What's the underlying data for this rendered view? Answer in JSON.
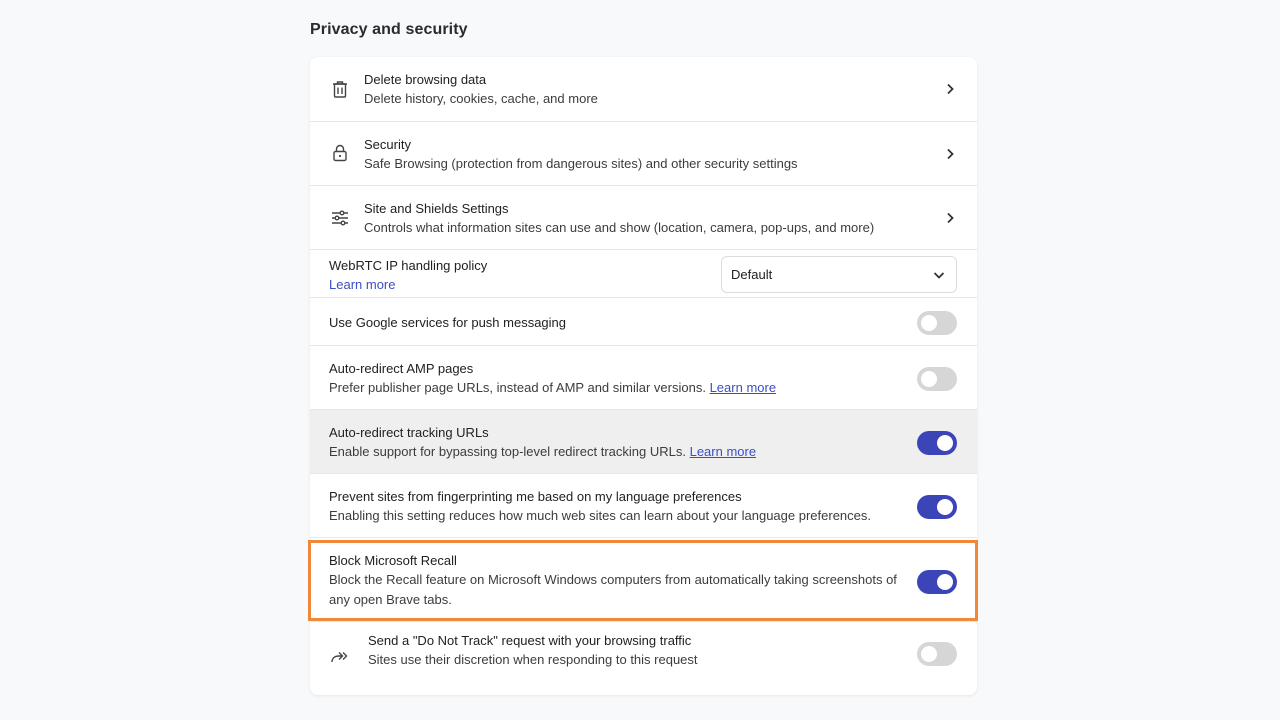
{
  "section": {
    "title": "Privacy and security"
  },
  "rows": {
    "delete": {
      "icon": "trash-icon",
      "title": "Delete browsing data",
      "subtitle": "Delete history, cookies, cache, and more"
    },
    "security": {
      "icon": "lock-icon",
      "title": "Security",
      "subtitle": "Safe Browsing (protection from dangerous sites) and other security settings"
    },
    "site_settings": {
      "icon": "sliders-icon",
      "title": "Site and Shields Settings",
      "subtitle": "Controls what information sites can use and show (location, camera, pop-ups, and more)"
    },
    "webrtc": {
      "title": "WebRTC IP handling policy",
      "link": "Learn more",
      "selected": "Default"
    },
    "push": {
      "title": "Use Google services for push messaging",
      "enabled": false
    },
    "amp": {
      "title": "Auto-redirect AMP pages",
      "subtitle": "Prefer publisher page URLs, instead of AMP and similar versions.",
      "link": "Learn more",
      "enabled": false
    },
    "tracking": {
      "title": "Auto-redirect tracking URLs",
      "subtitle": "Enable support for bypassing top-level redirect tracking URLs.",
      "link": "Learn more",
      "enabled": true
    },
    "fingerprint": {
      "title": "Prevent sites from fingerprinting me based on my language preferences",
      "subtitle": "Enabling this setting reduces how much web sites can learn about your language preferences.",
      "enabled": true
    },
    "recall": {
      "title": "Block Microsoft Recall",
      "subtitle": "Block the Recall feature on Microsoft Windows computers from automatically taking screenshots of any open Brave tabs.",
      "enabled": true
    },
    "dnt": {
      "icon": "forward-arrows-icon",
      "title": "Send a \"Do Not Track\" request with your browsing traffic",
      "subtitle": "Sites use their discretion when responding to this request",
      "enabled": false
    }
  },
  "colors": {
    "toggle_on": "#3c45b8",
    "toggle_off": "#d6d6d6",
    "link": "#3b4fc4",
    "highlight": "#f0883a"
  }
}
